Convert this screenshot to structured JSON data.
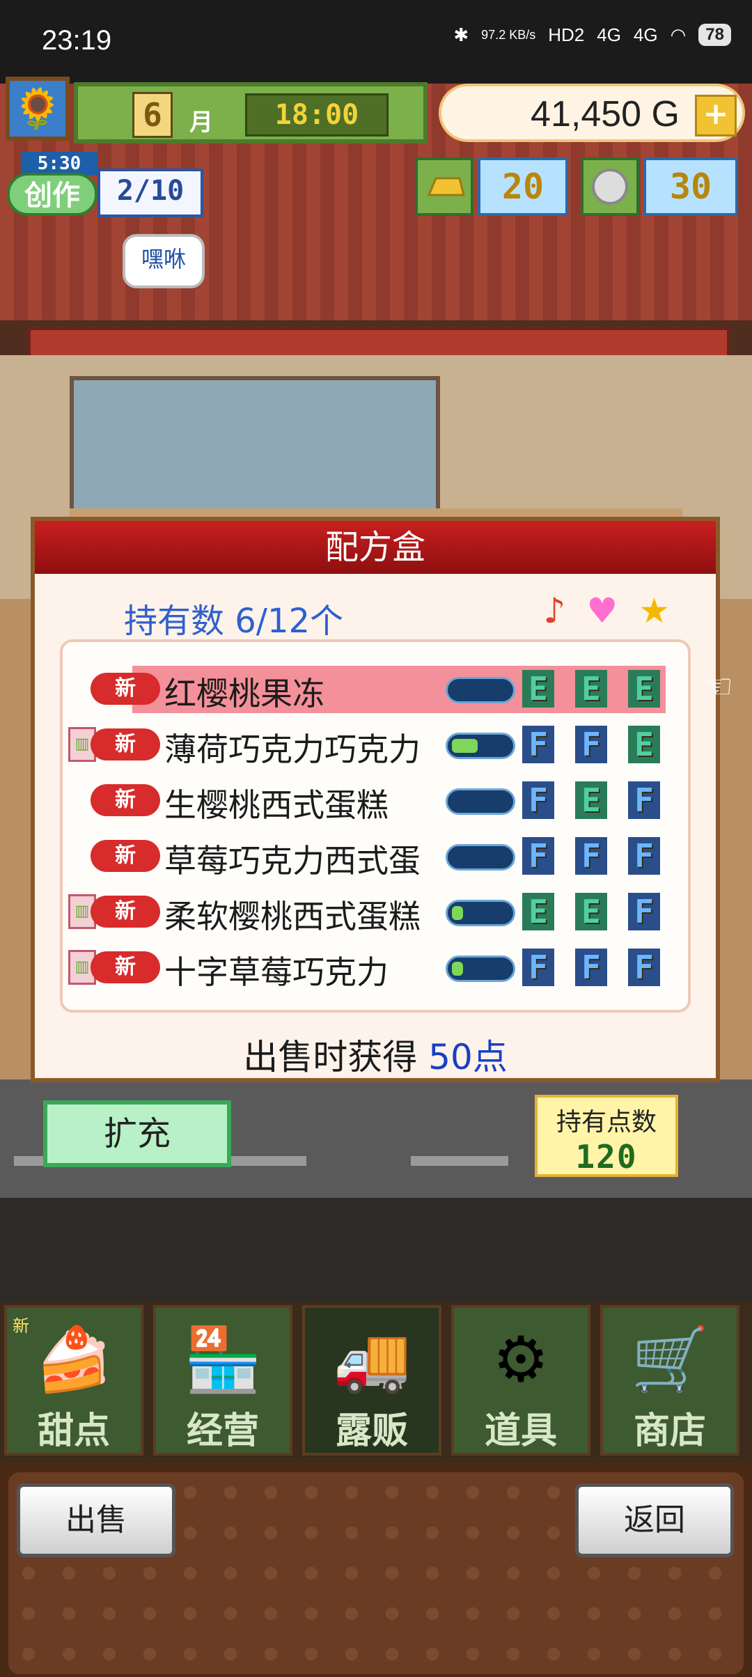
{
  "status_bar": {
    "time": "23:19",
    "network_speed": "97.2 KB/s",
    "signal_labels": [
      "HD2",
      "4G",
      "4G"
    ],
    "battery": "78"
  },
  "hud": {
    "month_number": "6",
    "month_label": "月",
    "clock": "18:00",
    "money": "41,450",
    "currency": "G",
    "create": {
      "timer": "5:30",
      "label": "创作",
      "progress": "2/10"
    },
    "gold_bars": "20",
    "medals": "30",
    "speech_bubble": "嘿咻"
  },
  "dialog": {
    "title": "配方盒",
    "owned_count": "持有数 6/12个",
    "header_icons": [
      "music-note-icon",
      "heart-icon",
      "star-icon"
    ],
    "recipes": [
      {
        "new_tag": "新",
        "name": "红樱桃果冻",
        "chef": false,
        "fill": 0.0,
        "grades": [
          "E",
          "E",
          "E"
        ],
        "selected": true
      },
      {
        "new_tag": "新",
        "name": "薄荷巧克力巧克力",
        "chef": true,
        "fill": 0.45,
        "grades": [
          "F",
          "F",
          "E"
        ],
        "selected": false
      },
      {
        "new_tag": "新",
        "name": "生樱桃西式蛋糕",
        "chef": false,
        "fill": 0.0,
        "grades": [
          "F",
          "E",
          "F"
        ],
        "selected": false
      },
      {
        "new_tag": "新",
        "name": "草莓巧克力西式蛋",
        "chef": false,
        "fill": 0.0,
        "grades": [
          "F",
          "F",
          "F"
        ],
        "selected": false
      },
      {
        "new_tag": "新",
        "name": "柔软樱桃西式蛋糕",
        "chef": true,
        "fill": 0.2,
        "grades": [
          "E",
          "E",
          "F"
        ],
        "selected": false
      },
      {
        "new_tag": "新",
        "name": "十字草莓巧克力",
        "chef": true,
        "fill": 0.2,
        "grades": [
          "F",
          "F",
          "F"
        ],
        "selected": false
      }
    ],
    "sell_info_prefix": "出售时获得",
    "sell_info_points": "50点"
  },
  "actions": {
    "expand": "扩充",
    "points_label": "持有点数",
    "points_value": "120"
  },
  "nav": {
    "items": [
      {
        "label": "甜点",
        "icon": "cake-icon",
        "new": "新",
        "active": false
      },
      {
        "label": "经营",
        "icon": "shop-icon",
        "new": "",
        "active": false
      },
      {
        "label": "露贩",
        "icon": "food-truck-icon",
        "new": "",
        "active": true
      },
      {
        "label": "道具",
        "icon": "items-icon",
        "new": "",
        "active": false
      },
      {
        "label": "商店",
        "icon": "cart-icon",
        "new": "",
        "active": false
      }
    ]
  },
  "bottom_buttons": {
    "sell": "出售",
    "back": "返回"
  }
}
